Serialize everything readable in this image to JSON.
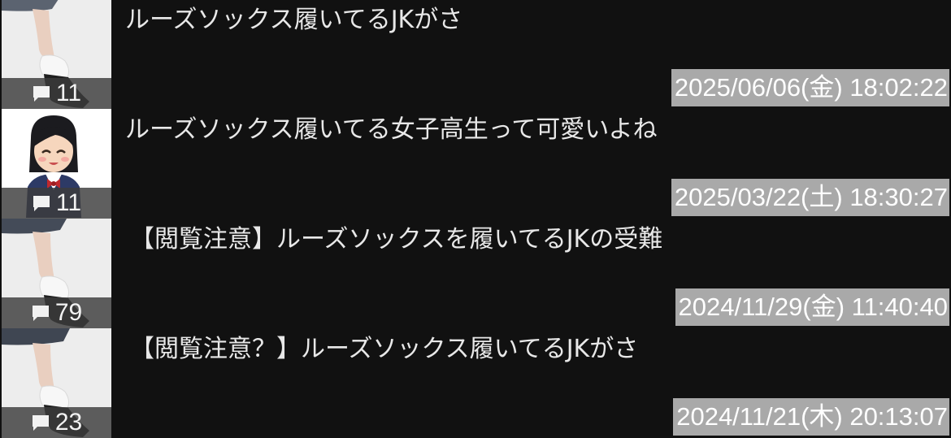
{
  "threads": [
    {
      "title": "ルーズソックス履いてるJKがさ",
      "count": "11",
      "date": "2025/06/06(金) 18:02:22",
      "thumb": "legs-photo"
    },
    {
      "title": "ルーズソックス履いてる女子高生って可愛いよね",
      "count": "11",
      "date": "2025/03/22(土) 18:30:27",
      "thumb": "schoolgirl-illustration"
    },
    {
      "title": "【閲覧注意】ルーズソックスを履いてるJKの受難",
      "count": "79",
      "date": "2024/11/29(金) 11:40:40",
      "thumb": "legs-photo"
    },
    {
      "title": "【閲覧注意？】ルーズソックス履いてるJKがさ",
      "count": "23",
      "date": "2024/11/21(木) 20:13:07",
      "thumb": "legs-photo"
    }
  ],
  "icons": {
    "comment": "comment-bubble-icon"
  },
  "colors": {
    "background": "#111111",
    "date_badge": "#a9a9a9",
    "count_bar": "#3c3c3c"
  }
}
